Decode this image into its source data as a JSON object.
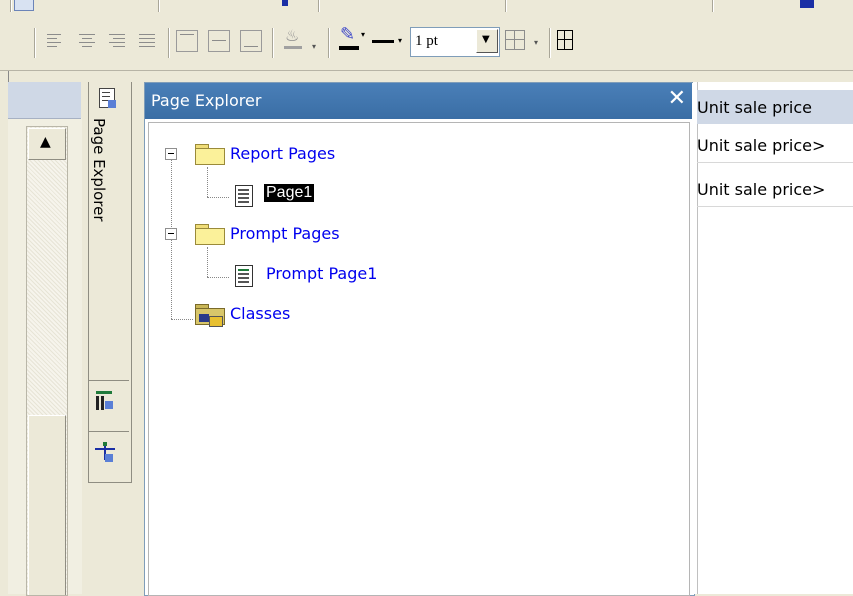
{
  "toolbar": {
    "line_width": "1 pt"
  },
  "page_explorer": {
    "title": "Page Explorer",
    "tab_label": "Page Explorer",
    "tree": {
      "report_pages": {
        "label": "Report Pages",
        "children": [
          "Page1"
        ]
      },
      "prompt_pages": {
        "label": "Prompt Pages",
        "children": [
          "Prompt Page1"
        ]
      },
      "classes": {
        "label": "Classes"
      }
    }
  },
  "data_area": {
    "cells": [
      "Unit sale price",
      "Unit sale price>",
      "Unit sale price>"
    ]
  },
  "colors": {
    "title_bar": "#3a6ea5",
    "link": "#0000ee",
    "selected": "#000000",
    "header_cell": "#cfd8e6"
  }
}
